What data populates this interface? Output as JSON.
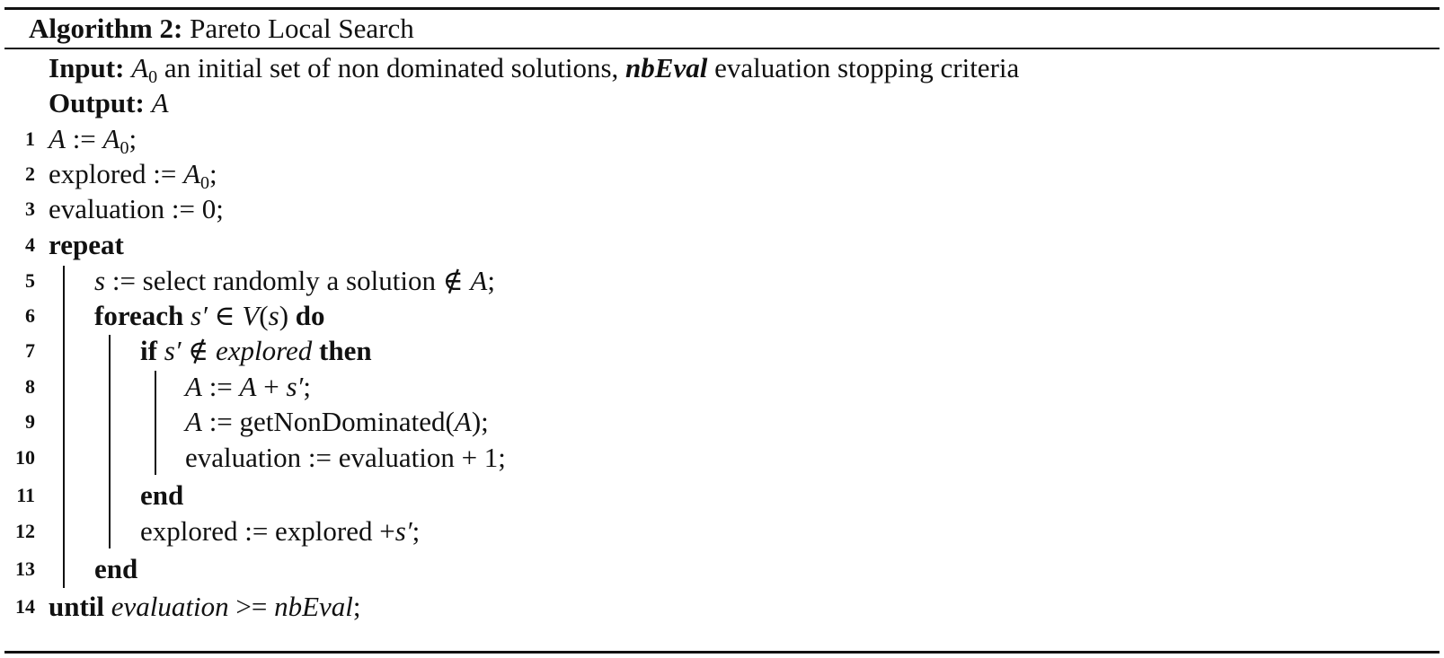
{
  "caption": {
    "label": "Algorithm 2:",
    "title": "Pareto Local Search"
  },
  "input": {
    "label": "Input:",
    "var": "A",
    "sub": "0",
    "text1": " an initial set of non dominated solutions, ",
    "param": "nbEval",
    "text2": " evaluation stopping criteria"
  },
  "output": {
    "label": "Output:",
    "value": "A"
  },
  "lines": {
    "l1": {
      "no": "1",
      "a": "A",
      "b": " := ",
      "c": "A",
      "d": "0",
      "e": ";"
    },
    "l2": {
      "no": "2",
      "a": "explored := ",
      "b": "A",
      "c": "0",
      "d": ";"
    },
    "l3": {
      "no": "3",
      "a": "evaluation := 0;"
    },
    "l4": {
      "no": "4",
      "kw": "repeat"
    },
    "l5": {
      "no": "5",
      "a": "s",
      "b": " := select randomly a solution ∉ ",
      "c": "A",
      "d": ";"
    },
    "l6": {
      "no": "6",
      "kw": "foreach",
      "a": " s′ ∈ ",
      "b": "V",
      "c": "(",
      "d": "s",
      "e": ") ",
      "kw2": "do"
    },
    "l7": {
      "no": "7",
      "kw": "if",
      "a": " s′ ∉ ",
      "b": "explored",
      "c": " ",
      "kw2": "then"
    },
    "l8": {
      "no": "8",
      "a": "A",
      "b": " := ",
      "c": "A",
      "d": " + ",
      "e": "s′",
      "f": ";"
    },
    "l9": {
      "no": "9",
      "a": "A",
      "b": " := getNonDominated(",
      "c": "A",
      "d": ");"
    },
    "l10": {
      "no": "10",
      "a": "evaluation := evaluation + 1;"
    },
    "l11": {
      "no": "11",
      "kw": "end"
    },
    "l12": {
      "no": "12",
      "a": "explored := explored +",
      "b": "s′",
      "c": ";"
    },
    "l13": {
      "no": "13",
      "kw": "end"
    },
    "l14": {
      "no": "14",
      "kw": "until",
      "a": " ",
      "b": "evaluation",
      "c": " >= ",
      "d": "nbEval",
      "e": ";"
    }
  }
}
